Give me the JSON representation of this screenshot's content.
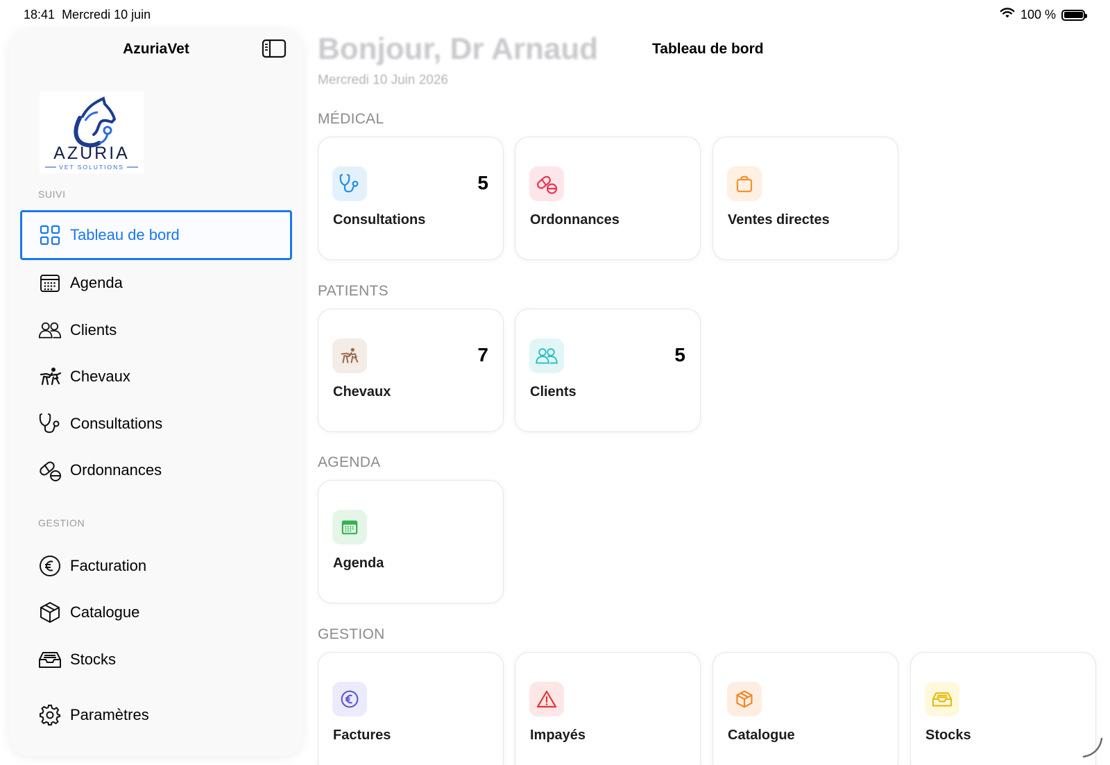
{
  "status": {
    "time": "18:41",
    "date": "Mercredi 10 juin",
    "battery": "100 %"
  },
  "sidebar": {
    "title": "AzuriaVet",
    "logo": {
      "name": "AZURIA",
      "tagline": "VET SOLUTIONS"
    },
    "sections": [
      {
        "label": "SUIVI"
      },
      {
        "label": "GESTION"
      }
    ],
    "items": [
      {
        "label": "Tableau de bord",
        "icon": "grid-icon",
        "active": true
      },
      {
        "label": "Agenda",
        "icon": "calendar-icon"
      },
      {
        "label": "Clients",
        "icon": "people-icon"
      },
      {
        "label": "Chevaux",
        "icon": "horse-rider-icon"
      },
      {
        "label": "Consultations",
        "icon": "stethoscope-icon"
      },
      {
        "label": "Ordonnances",
        "icon": "pills-icon"
      },
      {
        "label": "Facturation",
        "icon": "euro-icon"
      },
      {
        "label": "Catalogue",
        "icon": "box-icon"
      },
      {
        "label": "Stocks",
        "icon": "tray-icon"
      },
      {
        "label": "Paramètres",
        "icon": "gear-icon"
      }
    ]
  },
  "main": {
    "greeting": "Bonjour, Dr Arnaud",
    "date": "Mercredi 10 Juin 2026",
    "title": "Tableau de bord",
    "groups": [
      {
        "label": "MÉDICAL",
        "cards": [
          {
            "label": "Consultations",
            "count": "5",
            "icon": "stethoscope-icon"
          },
          {
            "label": "Ordonnances",
            "count": "",
            "icon": "pills-icon"
          },
          {
            "label": "Ventes directes",
            "count": "",
            "icon": "bag-icon"
          }
        ]
      },
      {
        "label": "PATIENTS",
        "cards": [
          {
            "label": "Chevaux",
            "count": "7",
            "icon": "horse-rider-icon"
          },
          {
            "label": "Clients",
            "count": "5",
            "icon": "people-icon"
          }
        ]
      },
      {
        "label": "AGENDA",
        "cards": [
          {
            "label": "Agenda",
            "count": "",
            "icon": "calendar-icon"
          }
        ]
      },
      {
        "label": "GESTION",
        "cards": [
          {
            "label": "Factures",
            "count": "",
            "icon": "euro-icon"
          },
          {
            "label": "Impayés",
            "count": "",
            "icon": "warning-icon"
          },
          {
            "label": "Catalogue",
            "count": "",
            "icon": "box-icon"
          },
          {
            "label": "Stocks",
            "count": "",
            "icon": "tray-icon"
          }
        ]
      }
    ]
  },
  "colors": {
    "accent": "#1877f2",
    "consultations_bg": "#e3f1fd",
    "consultations_fg": "#1f8ee6",
    "ordonnances_bg": "#fde6ea",
    "ordonnances_fg": "#e8344e",
    "ventes_bg": "#fef0e2",
    "ventes_fg": "#f2912f",
    "chevaux_bg": "#f3ece7",
    "chevaux_fg": "#9a6b4b",
    "clients_bg": "#e2f6f6",
    "clients_fg": "#2bbcc4",
    "agenda_bg": "#e5f6e8",
    "agenda_fg": "#31b34f",
    "factures_bg": "#ecebfd",
    "factures_fg": "#5b55d6",
    "impayes_bg": "#fde6e6",
    "impayes_fg": "#e53535",
    "catalogue_bg": "#feeee2",
    "catalogue_fg": "#f5841f",
    "stocks_bg": "#fef8dd",
    "stocks_fg": "#e8b80d"
  }
}
